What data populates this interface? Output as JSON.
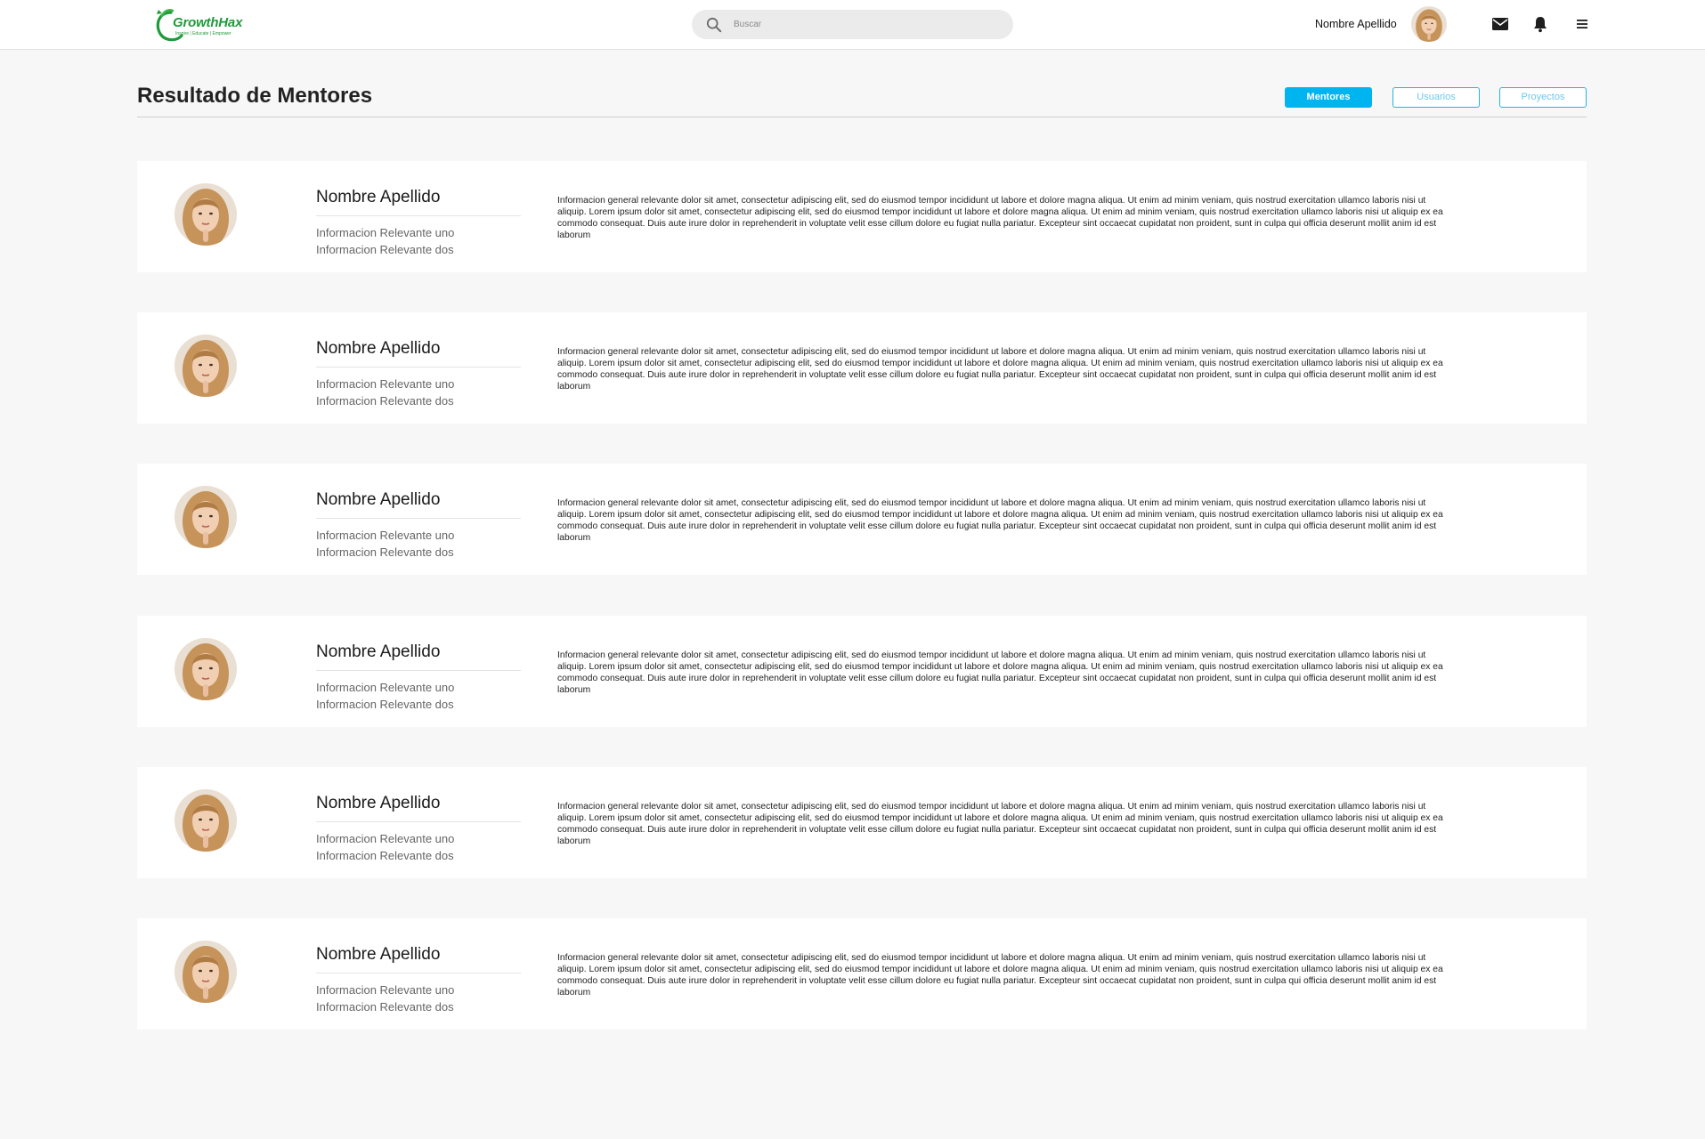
{
  "header": {
    "logo_text": "GrowthHax",
    "logo_tagline": "Inspire | Educate | Empower",
    "search_placeholder": "Buscar",
    "user_name": "Nombre Apellido"
  },
  "page": {
    "title": "Resultado de Mentores",
    "filters": [
      {
        "label": "Mentores",
        "active": true
      },
      {
        "label": "Usuarios",
        "active": false
      },
      {
        "label": "Proyectos",
        "active": false
      }
    ]
  },
  "mentors": [
    {
      "name": "Nombre Apellido",
      "info1": "Informacion Relevante uno",
      "info2": "Informacion Relevante dos",
      "description": "Informacion general relevante  dolor sit amet, consectetur adipiscing elit, sed do eiusmod tempor incididunt ut labore et dolore magna aliqua. Ut enim ad minim veniam, quis nostrud exercitation ullamco laboris nisi ut aliquip. Lorem ipsum dolor sit amet, consectetur adipiscing elit, sed do eiusmod tempor incididunt ut labore et dolore magna aliqua. Ut enim ad minim veniam, quis nostrud exercitation ullamco laboris nisi ut aliquip ex ea commodo consequat. Duis aute irure dolor in reprehenderit in voluptate velit esse cillum dolore eu fugiat nulla pariatur. Excepteur sint occaecat cupidatat non proident, sunt in culpa qui officia deserunt mollit anim id est laborum"
    },
    {
      "name": "Nombre Apellido",
      "info1": "Informacion Relevante uno",
      "info2": "Informacion Relevante dos",
      "description": "Informacion general relevante  dolor sit amet, consectetur adipiscing elit, sed do eiusmod tempor incididunt ut labore et dolore magna aliqua. Ut enim ad minim veniam, quis nostrud exercitation ullamco laboris nisi ut aliquip. Lorem ipsum dolor sit amet, consectetur adipiscing elit, sed do eiusmod tempor incididunt ut labore et dolore magna aliqua. Ut enim ad minim veniam, quis nostrud exercitation ullamco laboris nisi ut aliquip ex ea commodo consequat. Duis aute irure dolor in reprehenderit in voluptate velit esse cillum dolore eu fugiat nulla pariatur. Excepteur sint occaecat cupidatat non proident, sunt in culpa qui officia deserunt mollit anim id est laborum"
    },
    {
      "name": "Nombre Apellido",
      "info1": "Informacion Relevante uno",
      "info2": "Informacion Relevante dos",
      "description": "Informacion general relevante  dolor sit amet, consectetur adipiscing elit, sed do eiusmod tempor incididunt ut labore et dolore magna aliqua. Ut enim ad minim veniam, quis nostrud exercitation ullamco laboris nisi ut aliquip. Lorem ipsum dolor sit amet, consectetur adipiscing elit, sed do eiusmod tempor incididunt ut labore et dolore magna aliqua. Ut enim ad minim veniam, quis nostrud exercitation ullamco laboris nisi ut aliquip ex ea commodo consequat. Duis aute irure dolor in reprehenderit in voluptate velit esse cillum dolore eu fugiat nulla pariatur. Excepteur sint occaecat cupidatat non proident, sunt in culpa qui officia deserunt mollit anim id est laborum"
    },
    {
      "name": "Nombre Apellido",
      "info1": "Informacion Relevante uno",
      "info2": "Informacion Relevante dos",
      "description": "Informacion general relevante  dolor sit amet, consectetur adipiscing elit, sed do eiusmod tempor incididunt ut labore et dolore magna aliqua. Ut enim ad minim veniam, quis nostrud exercitation ullamco laboris nisi ut aliquip. Lorem ipsum dolor sit amet, consectetur adipiscing elit, sed do eiusmod tempor incididunt ut labore et dolore magna aliqua. Ut enim ad minim veniam, quis nostrud exercitation ullamco laboris nisi ut aliquip ex ea commodo consequat. Duis aute irure dolor in reprehenderit in voluptate velit esse cillum dolore eu fugiat nulla pariatur. Excepteur sint occaecat cupidatat non proident, sunt in culpa qui officia deserunt mollit anim id est laborum"
    },
    {
      "name": "Nombre Apellido",
      "info1": "Informacion Relevante uno",
      "info2": "Informacion Relevante dos",
      "description": "Informacion general relevante  dolor sit amet, consectetur adipiscing elit, sed do eiusmod tempor incididunt ut labore et dolore magna aliqua. Ut enim ad minim veniam, quis nostrud exercitation ullamco laboris nisi ut aliquip. Lorem ipsum dolor sit amet, consectetur adipiscing elit, sed do eiusmod tempor incididunt ut labore et dolore magna aliqua. Ut enim ad minim veniam, quis nostrud exercitation ullamco laboris nisi ut aliquip ex ea commodo consequat. Duis aute irure dolor in reprehenderit in voluptate velit esse cillum dolore eu fugiat nulla pariatur. Excepteur sint occaecat cupidatat non proident, sunt in culpa qui officia deserunt mollit anim id est laborum"
    },
    {
      "name": "Nombre Apellido",
      "info1": "Informacion Relevante uno",
      "info2": "Informacion Relevante dos",
      "description": "Informacion general relevante  dolor sit amet, consectetur adipiscing elit, sed do eiusmod tempor incididunt ut labore et dolore magna aliqua. Ut enim ad minim veniam, quis nostrud exercitation ullamco laboris nisi ut aliquip. Lorem ipsum dolor sit amet, consectetur adipiscing elit, sed do eiusmod tempor incididunt ut labore et dolore magna aliqua. Ut enim ad minim veniam, quis nostrud exercitation ullamco laboris nisi ut aliquip ex ea commodo consequat. Duis aute irure dolor in reprehenderit in voluptate velit esse cillum dolore eu fugiat nulla pariatur. Excepteur sint occaecat cupidatat non proident, sunt in culpa qui officia deserunt mollit anim id est laborum"
    }
  ],
  "colors": {
    "accent": "#00b4ef",
    "logo_green": "#1f9a3a",
    "background": "#f7f7f7"
  },
  "icons": [
    "search-icon",
    "mail-icon",
    "bell-icon",
    "menu-icon"
  ]
}
